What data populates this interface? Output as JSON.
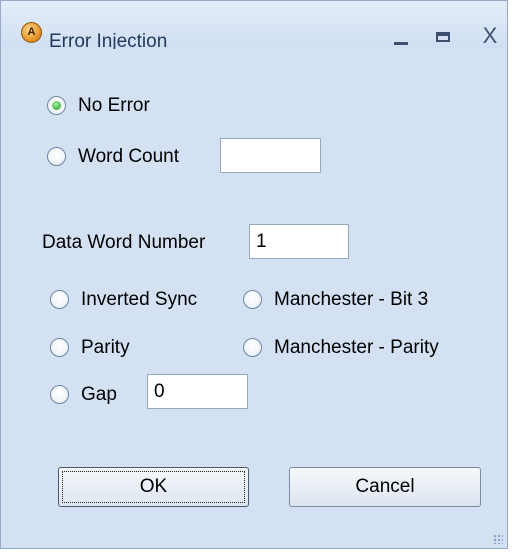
{
  "window": {
    "title": "Error Injection",
    "icon_name": "app-logo-icon",
    "icon_text": "A",
    "controls": {
      "minimize": "_",
      "maximize": "□",
      "close": "X"
    }
  },
  "options": {
    "no_error": {
      "label": "No Error",
      "checked": true
    },
    "word_count": {
      "label": "Word Count",
      "value": ""
    },
    "data_word_number": {
      "label": "Data Word Number",
      "value": "1"
    },
    "inverted_sync": {
      "label": "Inverted Sync",
      "checked": false
    },
    "manchester_bit3": {
      "label": "Manchester - Bit 3",
      "checked": false
    },
    "parity": {
      "label": "Parity",
      "checked": false
    },
    "manchester_parity": {
      "label": "Manchester - Parity",
      "checked": false
    },
    "gap": {
      "label": "Gap",
      "value": "0",
      "checked": false
    }
  },
  "buttons": {
    "ok": "OK",
    "cancel": "Cancel"
  },
  "colors": {
    "window_bg": "#d3e1f3",
    "title_text": "#1e395b",
    "radio_selected": "#1f9a27"
  }
}
